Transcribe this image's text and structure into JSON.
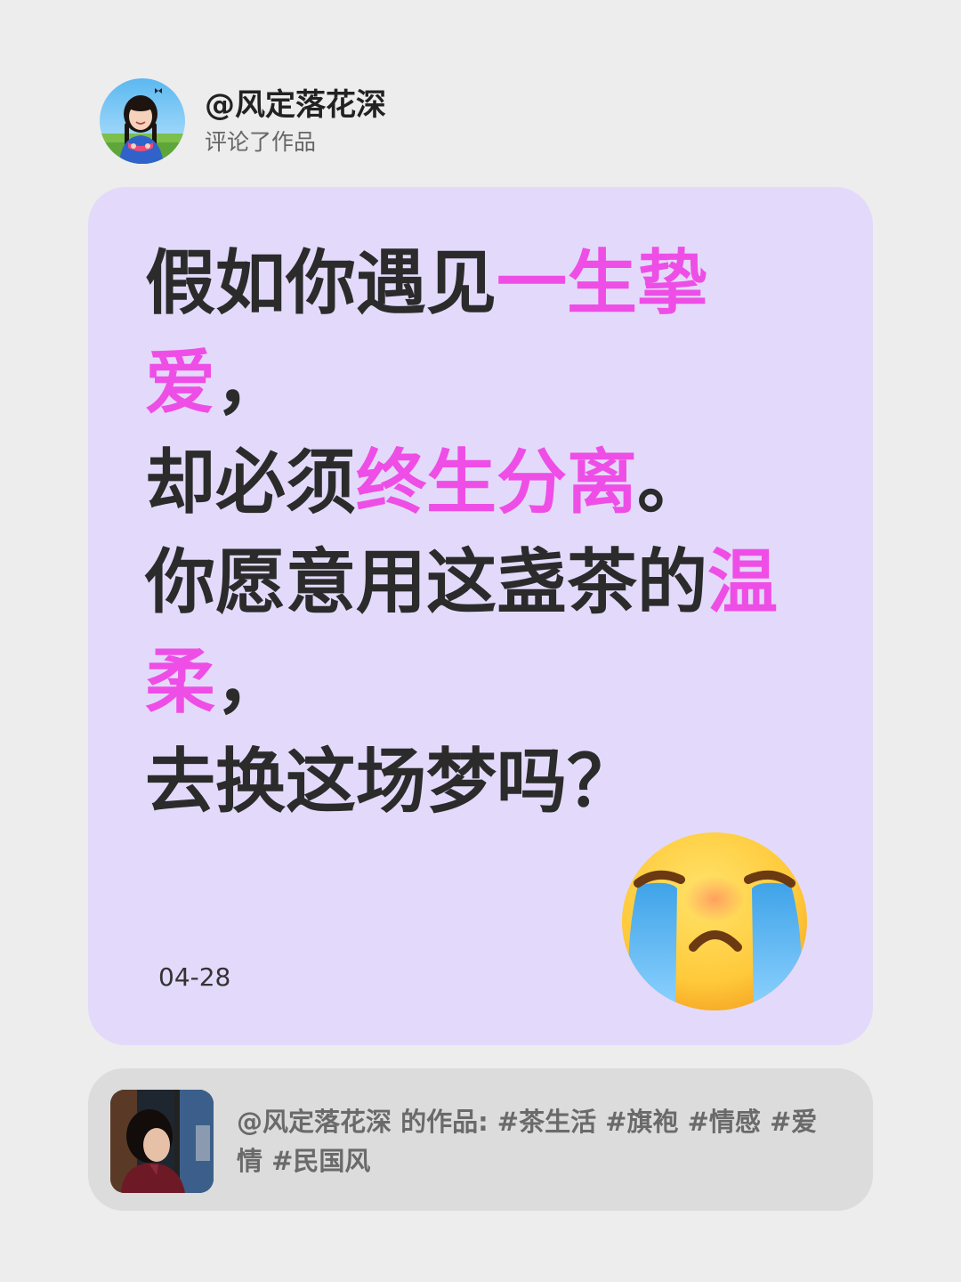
{
  "header": {
    "username": "@风定落花深",
    "action": "评论了作品"
  },
  "comment": {
    "lines": [
      {
        "plain": "假如你遇见",
        "highlight": "一生挚",
        "after": ""
      },
      {
        "plain": "",
        "highlight": "爱",
        "after": "，"
      },
      {
        "plain": "却必须",
        "highlight": "终生分离",
        "after": "。"
      },
      {
        "plain": "你愿意用这盏茶的",
        "highlight": "温",
        "after": ""
      },
      {
        "plain": "",
        "highlight": "柔",
        "after": "，"
      },
      {
        "plain": "去换这场梦吗？",
        "highlight": "",
        "after": ""
      }
    ],
    "date": "04-28",
    "emoji": "loudly-crying-face-emoji",
    "highlight_color": "#ee4ee6",
    "background_color": "#e3dafb"
  },
  "work": {
    "line1": "@风定落花深 的作品: #茶生活 #旗袍 #情感 #爱",
    "line2": "情 #民国风"
  }
}
